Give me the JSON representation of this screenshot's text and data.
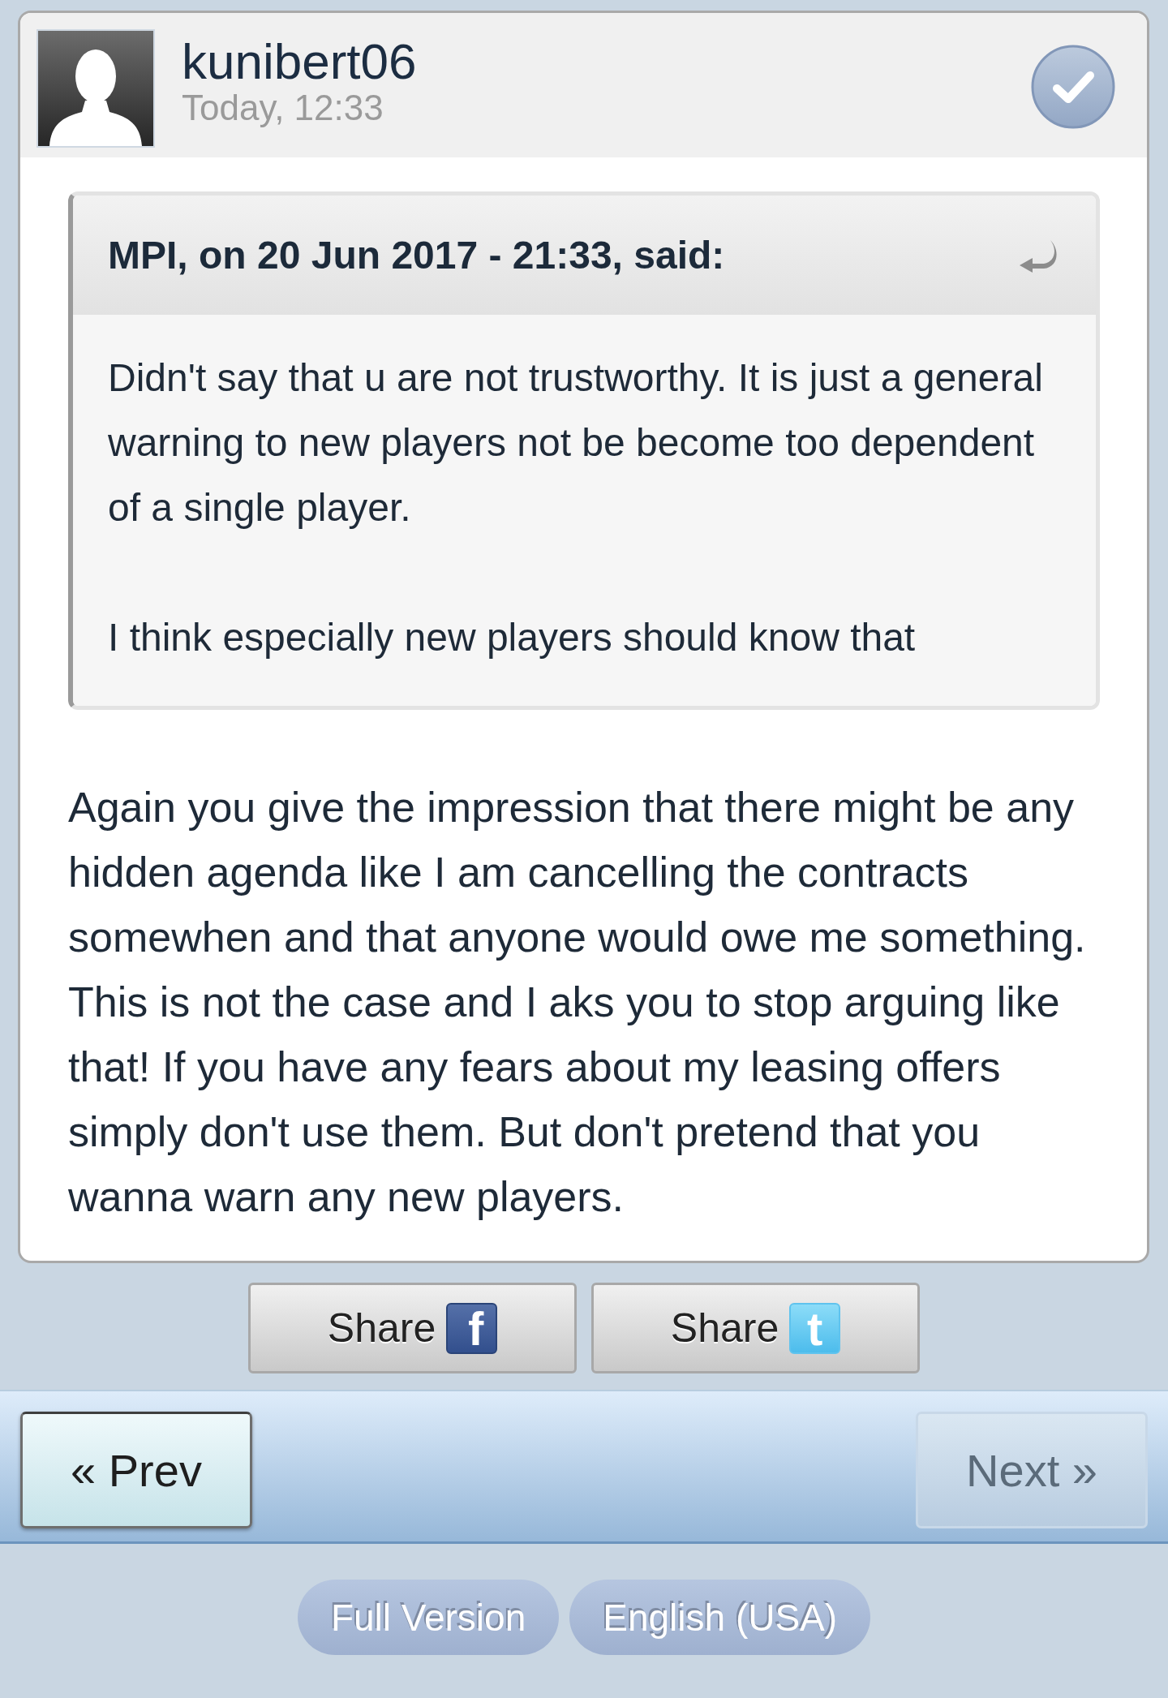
{
  "post": {
    "author": "kunibert06",
    "time": "Today, 12:33",
    "quote": {
      "citation": "MPI, on 20 Jun 2017 - 21:33, said:",
      "paragraphs": [
        "Didn't say that u are not trustworthy. It is just a general warning to new players not be become too dependent of a single player.",
        "I think especially new players should know that"
      ]
    },
    "body": "Again you give the impression that there might be any hidden agenda like I am cancelling the contracts somewhen and that anyone would owe me something. This is not the case and I aks you to stop arguing like that! If you have any fears about my leasing offers simply don't use them. But don't pretend that you wanna warn any new players."
  },
  "share_buttons": [
    {
      "label": "Share",
      "kind": "facebook",
      "icon": "f"
    },
    {
      "label": "Share",
      "kind": "twitter",
      "icon": "t"
    }
  ],
  "pagination": [
    {
      "label": "« Prev",
      "disabled": false
    },
    {
      "label": "Next »",
      "disabled": true
    }
  ],
  "footer_links": [
    "Full Version",
    "English (USA)"
  ]
}
